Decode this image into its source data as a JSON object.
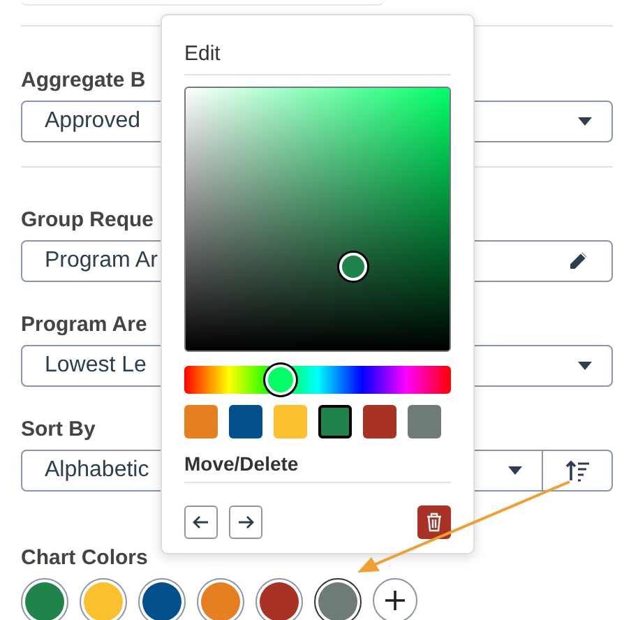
{
  "form": {
    "sections": [
      {
        "fields": [
          {
            "kind": "select",
            "label": "Aggregate B",
            "value": "Approved"
          }
        ]
      },
      {
        "fields": [
          {
            "kind": "edit",
            "label": "Group Reque",
            "value": "Program Ar"
          },
          {
            "kind": "select",
            "label": "Program Are",
            "value": "Lowest Le"
          },
          {
            "kind": "sort",
            "label": "Sort By",
            "value": "Alphabetic"
          }
        ]
      }
    ],
    "chart_colors": {
      "label": "Chart Colors",
      "swatches": [
        {
          "color": "#1e8449",
          "selected": false
        },
        {
          "color": "#fbc02d",
          "selected": false
        },
        {
          "color": "#03508c",
          "selected": false
        },
        {
          "color": "#e67e22",
          "selected": false
        },
        {
          "color": "#a93226",
          "selected": false
        },
        {
          "color": "#6f7b78",
          "selected": true
        }
      ]
    }
  },
  "popover": {
    "title": "Edit",
    "hue": {
      "level": 0.36
    },
    "presets": [
      {
        "color": "#e67e22",
        "selected": false
      },
      {
        "color": "#03508c",
        "selected": false
      },
      {
        "color": "#fbc02d",
        "selected": false
      },
      {
        "color": "#1e8449",
        "selected": true
      },
      {
        "color": "#a93226",
        "selected": false
      },
      {
        "color": "#6f7b78",
        "selected": false
      }
    ],
    "move_delete_label": "Move/Delete"
  }
}
